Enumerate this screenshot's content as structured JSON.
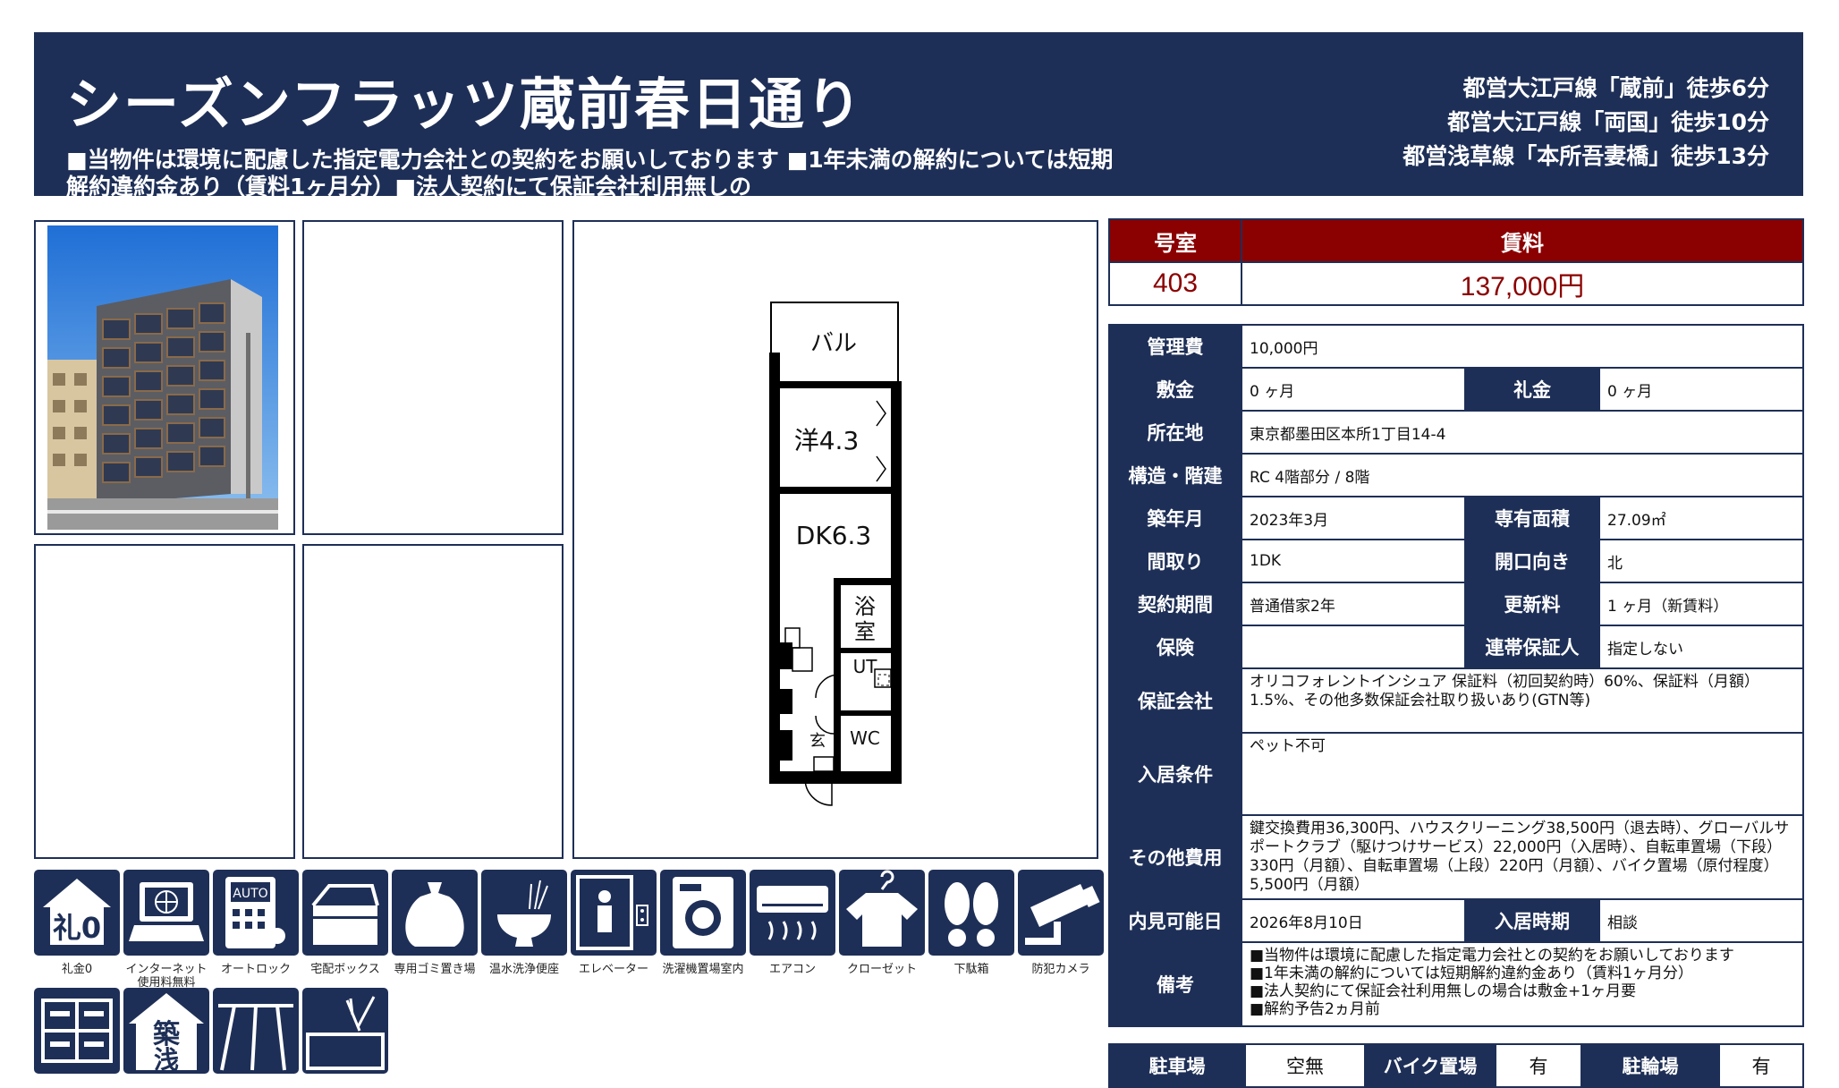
{
  "header": {
    "title": "シーズンフラッツ蔵前春日通り",
    "notes": "■当物件は環境に配慮した指定電力会社との契約をお願いしております ■1年未満の解約については短期解約違約金あり（賃料1ヶ月分）■法人契約にて保証会社利用無しの",
    "stations": [
      "都営大江戸線「蔵前」徒歩6分",
      "都営大江戸線「両国」徒歩10分",
      "都営浅草線「本所吾妻橋」徒歩13分"
    ]
  },
  "floorplan": {
    "rooms": [
      "バル",
      "洋4.3",
      "DK6.3",
      "浴",
      "室",
      "UT",
      "玄",
      "WC"
    ]
  },
  "amenities": [
    {
      "icon": "reikin-zero-icon",
      "label": "礼金0"
    },
    {
      "icon": "internet-icon",
      "label": "インターネット",
      "label2": "使用料無料"
    },
    {
      "icon": "autolock-icon",
      "label": "オートロック"
    },
    {
      "icon": "delivery-box-icon",
      "label": "宅配ボックス"
    },
    {
      "icon": "garbage-icon",
      "label": "専用ゴミ置き場"
    },
    {
      "icon": "washlet-icon",
      "label": "温水洗浄便座"
    },
    {
      "icon": "elevator-icon",
      "label": "エレベーター"
    },
    {
      "icon": "washer-icon",
      "label": "洗濯機置場室内"
    },
    {
      "icon": "aircon-icon",
      "label": "エアコン"
    },
    {
      "icon": "closet-icon",
      "label": "クローゼット"
    },
    {
      "icon": "shoe-box-icon",
      "label": "下駄箱"
    },
    {
      "icon": "security-camera-icon",
      "label": "防犯カメラ"
    }
  ],
  "amenities_row2": [
    {
      "icon": "storage-icon"
    },
    {
      "icon": "new-building-icon",
      "text": "築浅"
    },
    {
      "icon": "flooring-icon"
    },
    {
      "icon": "kitchen-icon"
    }
  ],
  "summary": {
    "room_label": "号室",
    "rent_label": "賃料",
    "room": "403",
    "rent": "137,000円"
  },
  "details": {
    "kanrihi_label": "管理費",
    "kanrihi": "10,000円",
    "shikikin_label": "敷金",
    "shikikin": "0 ヶ月",
    "reikin_label": "礼金",
    "reikin": "0 ヶ月",
    "address_label": "所在地",
    "address": "東京都墨田区本所1丁目14-4",
    "structure_label": "構造・階建",
    "structure": "RC 4階部分 / 8階",
    "built_label": "築年月",
    "built": "2023年3月",
    "area_label": "専有面積",
    "area": "27.09㎡",
    "layout_label": "間取り",
    "layout": "1DK",
    "facing_label": "開口向き",
    "facing": "北",
    "contract_label": "契約期間",
    "contract": "普通借家2年",
    "renewal_label": "更新料",
    "renewal": "1 ヶ月（新賃料）",
    "insurance_label": "保険",
    "insurance": "",
    "guarantor_label": "連帯保証人",
    "guarantor": "指定しない",
    "guarantee_co_label": "保証会社",
    "guarantee_co": "オリコフォレントインシュア 保証料（初回契約時）60%、保証料（月額）1.5%、その他多数保証会社取り扱いあり(GTN等)",
    "conditions_label": "入居条件",
    "conditions": "ペット不可",
    "other_label": "その他費用",
    "other": "鍵交換費用36,300円、ハウスクリーニング38,500円（退去時）、グローバルサポートクラブ（駆けつけサービス）22,000円（入居時）、自転車置場（下段）330円（月額）、自転車置場（上段）220円（月額）、バイク置場（原付程度）5,500円（月額）",
    "viewing_label": "内見可能日",
    "viewing": "2026年8月10日",
    "movein_label": "入居時期",
    "movein": "相談",
    "remarks_label": "備考",
    "remarks": [
      "■当物件は環境に配慮した指定電力会社との契約をお願いしております",
      "■1年未満の解約については短期解約違約金あり（賃料1ヶ月分）",
      "■法人契約にて保証会社利用無しの場合は敷金+1ヶ月要",
      "■解約予告2ヵ月前"
    ]
  },
  "parking": {
    "car_label": "駐車場",
    "car": "空無",
    "bike_label": "バイク置場",
    "bike": "有",
    "bicycle_label": "駐輪場",
    "bicycle": "有"
  },
  "colors": {
    "navy": "#1e2f57",
    "red": "#8b0000"
  }
}
